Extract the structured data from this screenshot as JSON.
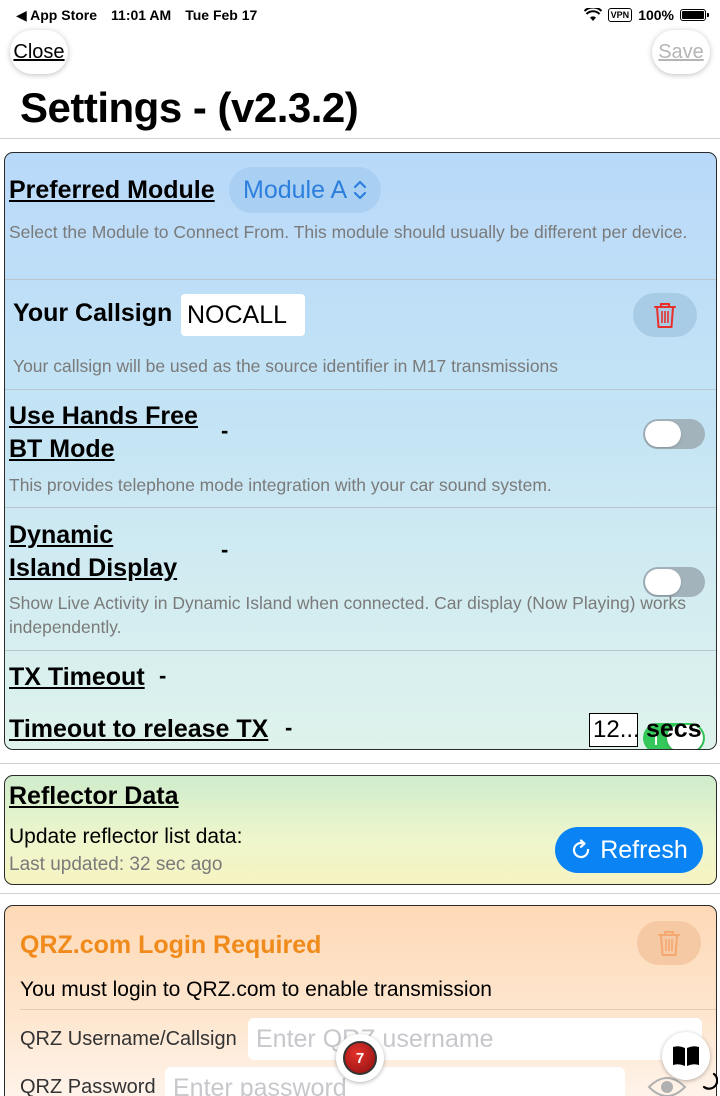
{
  "status_bar": {
    "back_app": "◀ App Store",
    "time": "11:01 AM",
    "date": "Tue Feb 17",
    "vpn": "VPN",
    "battery": "100%"
  },
  "nav": {
    "close_label": "Close",
    "save_label": "Save"
  },
  "title": "Settings - (v2.3.2)",
  "settings_card": {
    "preferred_module": {
      "label": "Preferred Module",
      "value": "Module A",
      "description": "Select the Module to Connect From.  This module should usually be different per device."
    },
    "callsign": {
      "label": "Your Callsign",
      "value": "NOCALL",
      "description": "Your callsign will be used as the source identifier in M17 transmissions"
    },
    "hands_free": {
      "label_line1": "Use Hands Free",
      "label_line2": "BT Mode",
      "dash": "-",
      "enabled": false,
      "description": "This provides telephone mode integration with your car sound system."
    },
    "dynamic_island": {
      "label_line1": "Dynamic",
      "label_line2": "Island Display",
      "dash": "-",
      "enabled": false,
      "description": "Show Live Activity in Dynamic Island when connected. Car display (Now Playing) works independently."
    },
    "tx_timeout": {
      "label": "TX Timeout",
      "dash": "-",
      "enabled": true
    },
    "timeout_release": {
      "label": "Timeout to release TX",
      "dash": "-",
      "value": "12...",
      "unit": "secs"
    }
  },
  "reflector_card": {
    "title": "Reflector Data",
    "update_text": "Update reflector list data:",
    "last_updated": "Last updated: 32 sec ago",
    "refresh_label": "Refresh"
  },
  "qrz_card": {
    "title": "QRZ.com Login Required",
    "message": "You must login to QRZ.com to enable transmission",
    "username_label": "QRZ Username/Callsign",
    "username_placeholder": "Enter QRZ username",
    "password_label": "QRZ Password",
    "password_placeholder": "Enter password"
  },
  "floating": {
    "badge_number": "7"
  },
  "colors": {
    "accent_blue": "#0a84f5",
    "toggle_on": "#34c759",
    "qrz_orange": "#f08a1a",
    "trash_red": "#e8302a"
  }
}
